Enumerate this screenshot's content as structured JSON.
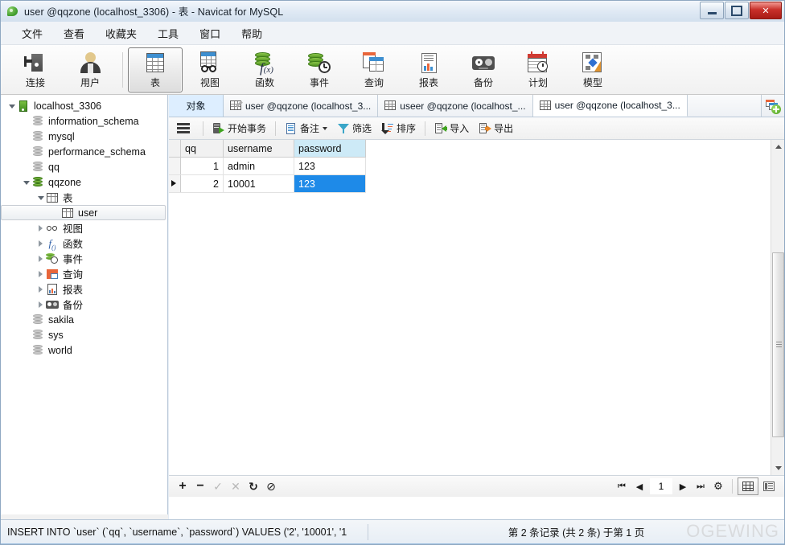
{
  "window": {
    "title": "user @qqzone (localhost_3306) - 表 - Navicat for MySQL",
    "app_icon": "navicat-leaf-icon",
    "controls": {
      "minimize": "minimize-icon",
      "maximize": "maximize-icon",
      "close": "✕"
    }
  },
  "menubar": {
    "items": [
      {
        "label": "文件"
      },
      {
        "label": "查看"
      },
      {
        "label": "收藏夹"
      },
      {
        "label": "工具"
      },
      {
        "label": "窗口"
      },
      {
        "label": "帮助"
      }
    ]
  },
  "toolbar": {
    "buttons": [
      {
        "label": "连接",
        "icon": "connection-icon",
        "active": false
      },
      {
        "label": "用户",
        "icon": "user-icon",
        "active": false
      },
      {
        "label": "表",
        "icon": "table-icon",
        "active": true
      },
      {
        "label": "视图",
        "icon": "view-icon",
        "active": false
      },
      {
        "label": "函数",
        "icon": "function-icon",
        "active": false
      },
      {
        "label": "事件",
        "icon": "event-icon",
        "active": false
      },
      {
        "label": "查询",
        "icon": "query-icon",
        "active": false
      },
      {
        "label": "报表",
        "icon": "report-icon",
        "active": false
      },
      {
        "label": "备份",
        "icon": "backup-icon",
        "active": false
      },
      {
        "label": "计划",
        "icon": "schedule-icon",
        "active": false
      },
      {
        "label": "模型",
        "icon": "model-icon",
        "active": false
      }
    ]
  },
  "sidebar": {
    "nodes": [
      {
        "label": "localhost_3306",
        "icon": "server-icon",
        "indent": 0,
        "expander": "down",
        "selected": false
      },
      {
        "label": "information_schema",
        "icon": "database-icon",
        "indent": 1,
        "expander": "none",
        "selected": false
      },
      {
        "label": "mysql",
        "icon": "database-icon",
        "indent": 1,
        "expander": "none",
        "selected": false
      },
      {
        "label": "performance_schema",
        "icon": "database-icon",
        "indent": 1,
        "expander": "none",
        "selected": false
      },
      {
        "label": "qq",
        "icon": "database-icon",
        "indent": 1,
        "expander": "none",
        "selected": false
      },
      {
        "label": "qqzone",
        "icon": "database-open-icon",
        "indent": 1,
        "expander": "down",
        "selected": false
      },
      {
        "label": "表",
        "icon": "table-icon",
        "indent": 2,
        "expander": "down",
        "selected": false
      },
      {
        "label": "user",
        "icon": "table-icon",
        "indent": 3,
        "expander": "none",
        "selected": true
      },
      {
        "label": "视图",
        "icon": "view-icon",
        "indent": 2,
        "expander": "right",
        "selected": false
      },
      {
        "label": "函数",
        "icon": "function-icon",
        "indent": 2,
        "expander": "right",
        "selected": false
      },
      {
        "label": "事件",
        "icon": "event-icon",
        "indent": 2,
        "expander": "right",
        "selected": false
      },
      {
        "label": "查询",
        "icon": "query-icon",
        "indent": 2,
        "expander": "right",
        "selected": false
      },
      {
        "label": "报表",
        "icon": "report-icon",
        "indent": 2,
        "expander": "right",
        "selected": false
      },
      {
        "label": "备份",
        "icon": "backup-icon",
        "indent": 2,
        "expander": "right",
        "selected": false
      },
      {
        "label": "sakila",
        "icon": "database-icon",
        "indent": 1,
        "expander": "none",
        "selected": false
      },
      {
        "label": "sys",
        "icon": "database-icon",
        "indent": 1,
        "expander": "none",
        "selected": false
      },
      {
        "label": "world",
        "icon": "database-icon",
        "indent": 1,
        "expander": "none",
        "selected": false
      }
    ]
  },
  "tabs": {
    "items": [
      {
        "label": "对象",
        "icon": "objects-icon",
        "state": "objects"
      },
      {
        "label": "user @qqzone (localhost_3...",
        "icon": "table-design-icon",
        "state": "inactive"
      },
      {
        "label": "useer @qqzone (localhost_...",
        "icon": "table-data-icon",
        "state": "inactive"
      },
      {
        "label": "user @qqzone (localhost_3...",
        "icon": "table-data-icon",
        "state": "active"
      }
    ],
    "add_button": "new-tab-icon"
  },
  "grid_toolbar": {
    "menu_icon": "hamburger-icon",
    "buttons": [
      {
        "label": "开始事务",
        "icon": "begin-transaction-icon",
        "caret": false
      },
      {
        "label": "备注",
        "icon": "note-icon",
        "caret": true
      },
      {
        "label": "筛选",
        "icon": "filter-icon",
        "caret": false
      },
      {
        "label": "排序",
        "icon": "sort-icon",
        "caret": false
      },
      {
        "label": "导入",
        "icon": "import-icon",
        "caret": false
      },
      {
        "label": "导出",
        "icon": "export-icon",
        "caret": false
      }
    ]
  },
  "table": {
    "columns": [
      {
        "name": "qq",
        "highlighted": false
      },
      {
        "name": "username",
        "highlighted": false
      },
      {
        "name": "password",
        "highlighted": true
      }
    ],
    "rows": [
      {
        "current": false,
        "cells": [
          "1",
          "admin",
          "123"
        ],
        "selected_cell": -1
      },
      {
        "current": true,
        "cells": [
          "2",
          "10001",
          "123"
        ],
        "selected_cell": 2
      }
    ]
  },
  "record_nav": {
    "add_label": "+",
    "remove_label": "−",
    "confirm_label": "✓",
    "cancel_label": "✕",
    "refresh_label": "↻",
    "stop_label": "⊘",
    "first_label": "⏮",
    "prev_label": "◀",
    "page_value": "1",
    "next_label": "▶",
    "last_label": "⏭",
    "settings_label": "⚙",
    "grid_view": "grid-view-icon",
    "form_view": "form-view-icon"
  },
  "statusbar": {
    "sql": "INSERT INTO `user` (`qq`, `username`, `password`) VALUES ('2', '10001', '1",
    "record_info": "第 2 条记录 (共 2 条) 于第 1 页",
    "watermark": "OGEWING"
  },
  "colors": {
    "selection_blue": "#1e8ae8",
    "header_highlight": "#cdeaf7",
    "tab_objects_bg": "#ddeeff",
    "accent_green": "#4f9020",
    "close_red": "#c8302a"
  }
}
